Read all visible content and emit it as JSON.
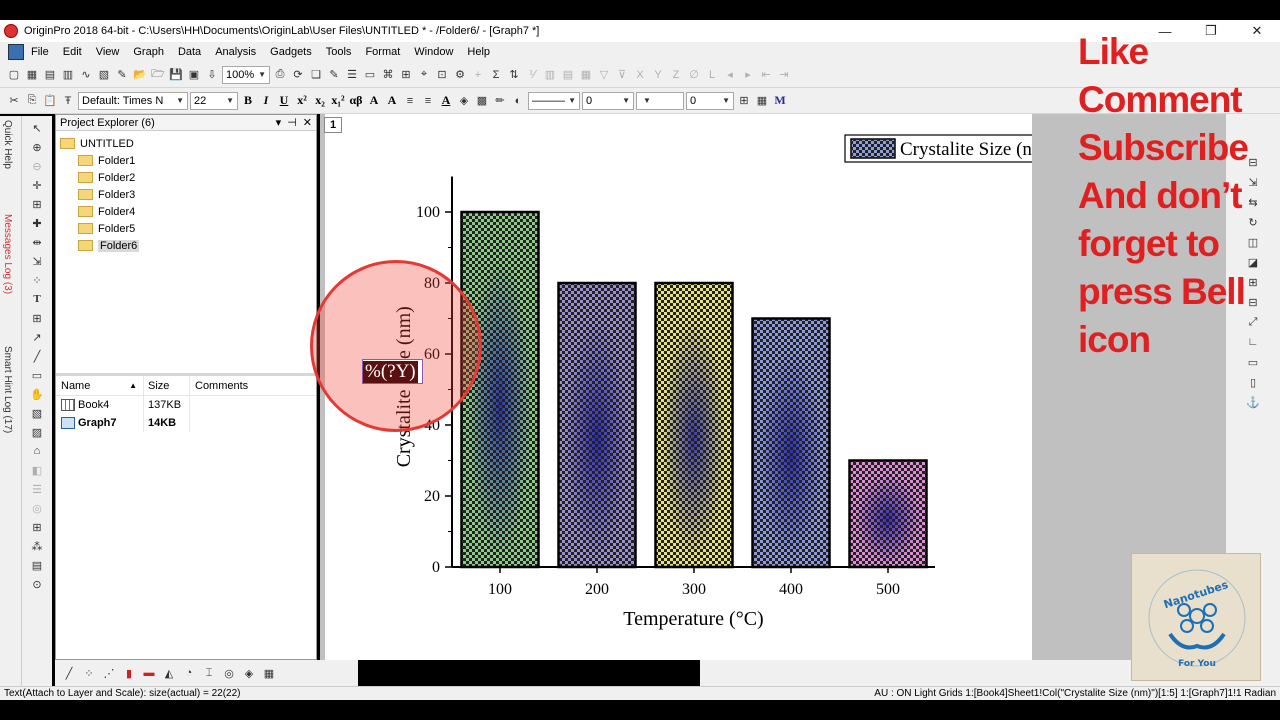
{
  "window": {
    "title": "OriginPro 2018 64-bit - C:\\Users\\HH\\Documents\\OriginLab\\User Files\\UNTITLED * - /Folder6/ - [Graph7 *]",
    "min": "—",
    "restore": "❐",
    "close": "✕"
  },
  "menu": [
    "File",
    "Edit",
    "View",
    "Graph",
    "Data",
    "Analysis",
    "Gadgets",
    "Tools",
    "Format",
    "Window",
    "Help"
  ],
  "toolbar": {
    "zoom": "100%",
    "font": "Default: Times N",
    "font_size": "22",
    "line_width": "0",
    "fill_pattern": "0"
  },
  "left_tabs": [
    "Quick Help",
    "Messages Log (3)",
    "Smart Hint Log (17)"
  ],
  "project_explorer": {
    "title": "Project Explorer (6)",
    "root": "UNTITLED",
    "folders": [
      "Folder1",
      "Folder2",
      "Folder3",
      "Folder4",
      "Folder5",
      "Folder6"
    ],
    "columns": [
      "Name",
      "Size",
      "Comments"
    ],
    "items": [
      {
        "name": "Book4",
        "size": "137KB",
        "comments": ""
      },
      {
        "name": "Graph7",
        "size": "14KB",
        "comments": ""
      }
    ]
  },
  "graph": {
    "layer": "1",
    "legend": "Crystalite Size (nm)",
    "editing_label": "%(?Y)",
    "highlight_color": "#f44336",
    "chart_data": {
      "type": "bar",
      "categories": [
        "100",
        "200",
        "300",
        "400",
        "500"
      ],
      "values": [
        100,
        80,
        80,
        70,
        30
      ],
      "xlabel": "Temperature (°C)",
      "ylabel": "Crystalite Size (nm)",
      "ylim": [
        0,
        110
      ],
      "yticks": [
        "0",
        "20",
        "40",
        "60",
        "80",
        "100"
      ],
      "grid": false,
      "legend_position": "top-right",
      "colors": [
        "#8fc98a",
        "#9a8fc9",
        "#e6e086",
        "#8f9ad9",
        "#d98fd0"
      ]
    }
  },
  "status": {
    "left": "Text(Attach to Layer and Scale): size(actual) = 22(22)",
    "right": "AU : ON  Light Grids  1:[Book4]Sheet1!Col(\"Crystalite Size (nm)\")[1:5]  1:[Graph7]1!1  Radian"
  },
  "overlay": [
    "Like",
    "Comment",
    "Subscribe",
    "And don’t",
    "forget to",
    "press Bell",
    "icon"
  ],
  "logo": {
    "top": "Nanotubes",
    "bottom": "For You"
  }
}
